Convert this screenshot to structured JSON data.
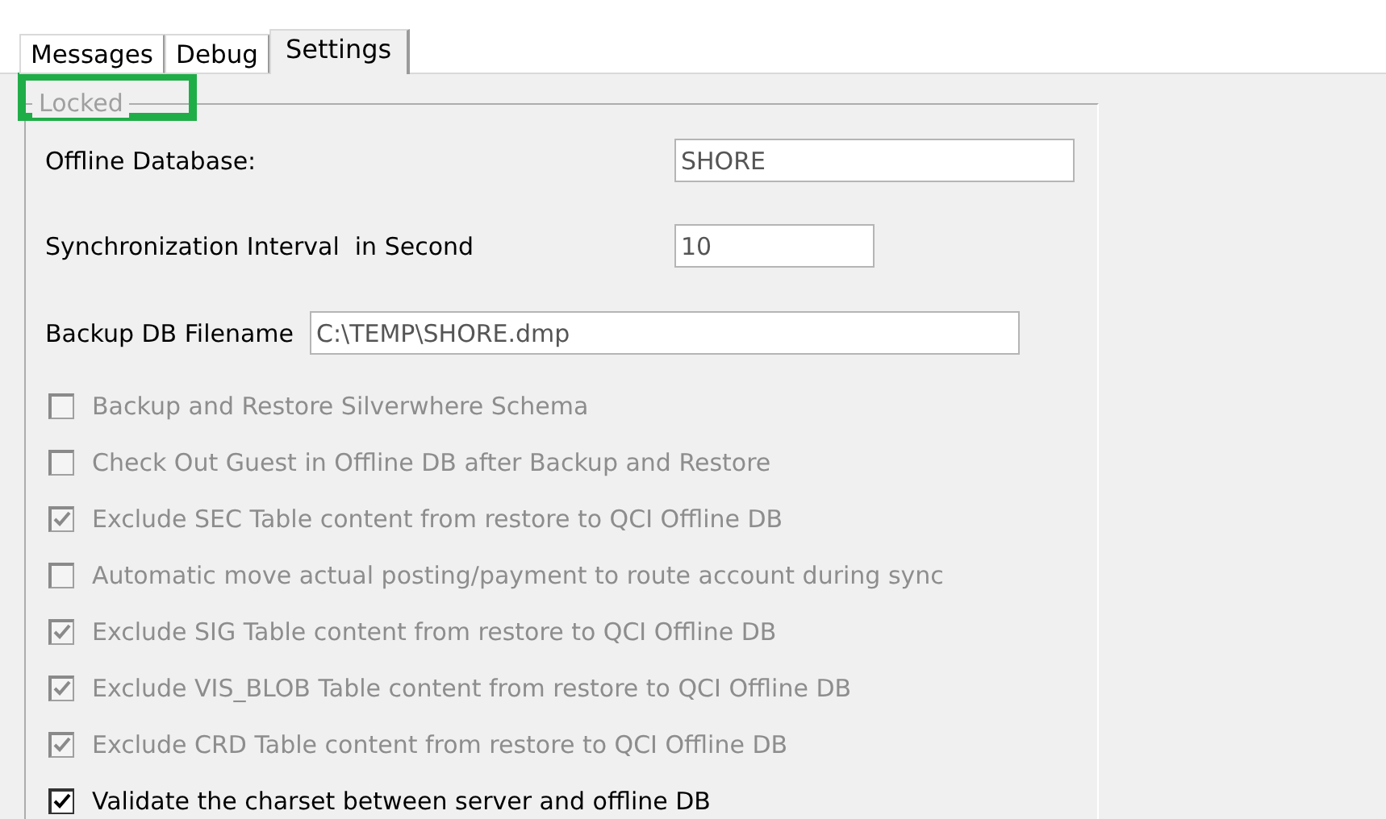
{
  "tabs": [
    {
      "label": "Messages",
      "selected": false
    },
    {
      "label": "Debug",
      "selected": false
    },
    {
      "label": "Settings",
      "selected": true
    }
  ],
  "group": {
    "title": "Locked",
    "highlighted": true,
    "disabled": true
  },
  "fields": [
    {
      "label": "Offline Database:",
      "value": "SHORE",
      "kind": "wide"
    },
    {
      "label": "Synchronization Interval  in Second",
      "value": "10",
      "kind": "short"
    },
    {
      "label": "Backup DB Filename",
      "value": "C:\\TEMP\\SHORE.dmp",
      "kind": "inline"
    }
  ],
  "options": [
    {
      "label": "Backup and Restore Silverwhere Schema",
      "checked": false,
      "disabled": true
    },
    {
      "label": "Check Out Guest in Offline DB after Backup and Restore",
      "checked": false,
      "disabled": true
    },
    {
      "label": "Exclude SEC Table content from restore to QCI Offline DB",
      "checked": true,
      "disabled": true
    },
    {
      "label": "Automatic move actual posting/payment to route account during sync",
      "checked": false,
      "disabled": true
    },
    {
      "label": "Exclude SIG Table content from restore to QCI Offline DB",
      "checked": true,
      "disabled": true
    },
    {
      "label": "Exclude VIS_BLOB Table content from restore to QCI Offline DB",
      "checked": true,
      "disabled": true
    },
    {
      "label": "Exclude CRD Table content from restore to QCI Offline DB",
      "checked": true,
      "disabled": true
    },
    {
      "label": "Validate the charset between server and offline DB",
      "checked": true,
      "disabled": false
    }
  ]
}
